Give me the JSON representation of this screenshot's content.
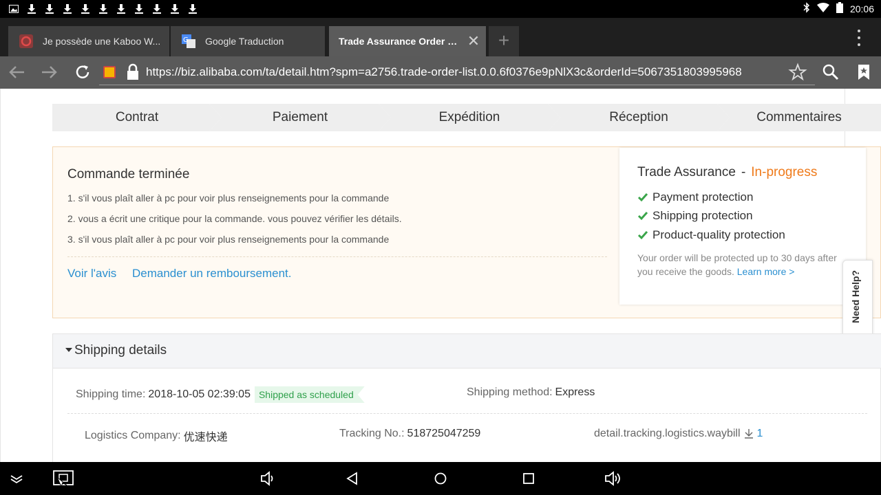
{
  "status_bar": {
    "time": "20:06",
    "notification_icons": [
      "image-icon",
      "download-icon",
      "download-icon",
      "download-icon",
      "download-icon",
      "download-icon",
      "download-icon",
      "download-icon",
      "download-icon",
      "download-icon",
      "download-icon"
    ]
  },
  "tabs": [
    {
      "label": "Je possède une Kaboo W...",
      "favicon": "opera-icon"
    },
    {
      "label": "Google Traduction",
      "favicon": "google-translate-icon"
    },
    {
      "label": "Trade Assurance Order D...",
      "favicon": "",
      "active": true,
      "close": "✕"
    }
  ],
  "toolbar": {
    "url": "https://biz.alibaba.com/ta/detail.htm?spm=a2756.trade-order-list.0.0.6f0376e9pNlX3c&orderId=5067351803995968"
  },
  "steps": [
    "Contrat",
    "Paiement",
    "Expédition",
    "Réception",
    "Commentaires"
  ],
  "order": {
    "title": "Commande terminée",
    "notes": [
      "1. s'il vous plaît aller à pc pour voir plus renseignements pour la commande",
      "2. vous a écrit une critique pour la commande. vous pouvez vérifier les détails.",
      "3. s'il vous plaît aller à pc pour voir plus renseignements pour la commande"
    ],
    "link_review": "Voir l'avis",
    "link_refund": "Demander un remboursement."
  },
  "trade_assurance": {
    "title": "Trade Assurance",
    "separator": "-",
    "status": "In-progress",
    "protections": [
      "Payment protection",
      "Shipping protection",
      "Product-quality protection"
    ],
    "description": "Your order will be protected up to 30 days after you receive the goods.",
    "learn_more": "Learn more >"
  },
  "help": {
    "label": "Need Help?"
  },
  "shipping": {
    "section_title": "Shipping details",
    "time_label": "Shipping time:",
    "time_value": "2018-10-05 02:39:05",
    "badge": "Shipped as scheduled",
    "method_label": "Shipping method:",
    "method_value": "Express",
    "company_label": "Logistics Company:",
    "company_value": "优速快递",
    "tracking_label": "Tracking No.:",
    "tracking_value": "518725047259",
    "waybill_label": "detail.tracking.logistics.waybill",
    "waybill_count": "1"
  },
  "colors": {
    "accent_orange": "#ef7a1a",
    "link_blue": "#2a8fd0",
    "success_green": "#2fa04b"
  }
}
